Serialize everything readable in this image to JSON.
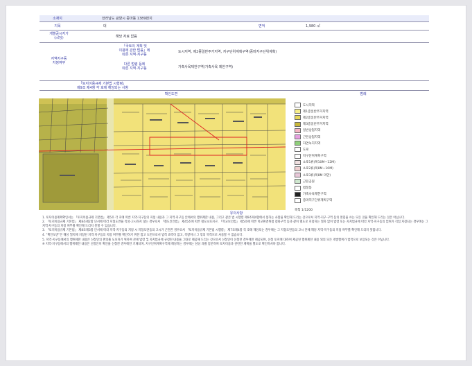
{
  "header": {
    "col1": "소재지",
    "col2": "전라남도 광양시 중마동 1389번지"
  },
  "rows": {
    "jimok_label": "지목",
    "jimok_value": "대",
    "area_label": "면적",
    "area_value": "1,980 ㎡",
    "price_label": "개별공시지가\n(㎡당)",
    "price_value": "해당 자료 없음",
    "zoning_label": "지역지구등\n지정여부",
    "zoning_sub1": "「국토의 계획 및\n이용에 관한 법률」에\n따른 지역·지구등",
    "zoning_val1": "도시지역, 제2종일반주거지역, 지구단위계획구역(중마지구단위계획)",
    "zoning_sub2": "다른 법령 등에\n따른 지역·지구등",
    "zoning_val2": "가축사육제한구역(가축사육 제한구역)",
    "extra_label": "「토지이용규제 기본법 시행령」\n제9조 제4항 각 호에 해당되는 사항"
  },
  "map_section": {
    "title": "확인도면",
    "legend_title": "범례"
  },
  "legend": [
    {
      "label": "도시지역",
      "color": "#ffffff"
    },
    {
      "label": "제1종일반주거지역",
      "color": "#f7ee8a"
    },
    {
      "label": "제2종일반주거지역",
      "color": "#e6d65a"
    },
    {
      "label": "제3종일반주거지역",
      "color": "#c9b83a"
    },
    {
      "label": "일반상업지역",
      "color": "#f5b5c4"
    },
    {
      "label": "근린상업지역",
      "color": "#e6a0e0"
    },
    {
      "label": "자연녹지지역",
      "color": "#8fcf7a"
    },
    {
      "label": "도로",
      "color": "#ffffff"
    },
    {
      "label": "지구단위계획구역",
      "color": "#ffffff"
    },
    {
      "label": "소로1류(폭10M~12M)",
      "color": "#f0e0e0"
    },
    {
      "label": "소로2류(폭8M~10M)",
      "color": "#f0d0d0"
    },
    {
      "label": "소로3류(폭8M 미만)",
      "color": "#e8c8d8"
    },
    {
      "label": "근린공원",
      "color": "#cfe8cf"
    },
    {
      "label": "법정동",
      "color": "#ffffff"
    },
    {
      "label": "가축사육제한구역",
      "color": "#222222"
    },
    {
      "label": "중마지구단위계획구역",
      "color": "#ffffff"
    }
  ],
  "legend_scale": "축척 1/1200",
  "notes_title": "유의사항",
  "notes": [
    "1. 토지이용계획확인서는 「토지이용규제 기본법」 제5조 각 호에 따른 지역·지구등의 지정 내용과 그 지역·지구등 안에서의 행위제한 내용, 그리고 같은 법 시행령 제9조제4항에서 정하는 사항을 확인해 드리는 것으로서 지역·지구·구역 등의 명칭을 쓰는 모든 것을 확인해 드리는 것은 아닙니다.",
    "2. 「토지이용규제 기본법」 제8조제2항 단서에 따라 지형도면을 작성·고시하지 않는 경우로서 「철도안전법」 제45조에 따른 철도보호지구, 「학교보건법」 제5조에 따른 학교환경위생 정화구역 등과 같이 별도로 지정하는 절차 없이 법령 또는 자치법규에 따라 지역·지구등의 범위가 직접 지정되는 경우에는 그 지역·지구등의 지정 여부를 확인해 드리지 못할 수 있습니다.",
    "3. 「토지이용규제 기본법」 제8조제3항 단서에 따라 지역·지구등의 지정 시 지형도면등의 고시가 곤란한 경우로서 「토지이용규제 기본법 시행령」 제7조제4항 각 호에 해당되는 경우에는 그 지형도면등의 고시 전에 해당 지역·지구등의 지정 여부를 확인해 드리지 못합니다.",
    "4. \"확인도면\"은 해당 필지에 지정된 지역·지구등의 지정 여부를 확인하기 위한 참고 도면으로서 법적 효력이 없고, 측량이나 그 밖의 목적으로 사용할 수 없습니다.",
    "5. 지역·지구등에서의 행위제한 내용은 신청인의 편의를 도모하기 위하여 관계 법령 및 자치법규에 규정된 내용을 그대로 제공해 드리는 것으로서 신청인이 신청한 경우에만 제공되며, 신청 토지에 대하여 제공된 행위제한 내용 외의 모든 개발행위가 법적으로 보장되는 것은 아닙니다.",
    "※ 지역·지구등에서의 행위제한 내용은 신청인이 확인을 신청한 경우에만 기재되며, 지구단위계획구역에 해당하는 경우에는 담당 과를 방문하여 토지이용과 관련한 계획을 별도로 확인하셔야 합니다."
  ]
}
